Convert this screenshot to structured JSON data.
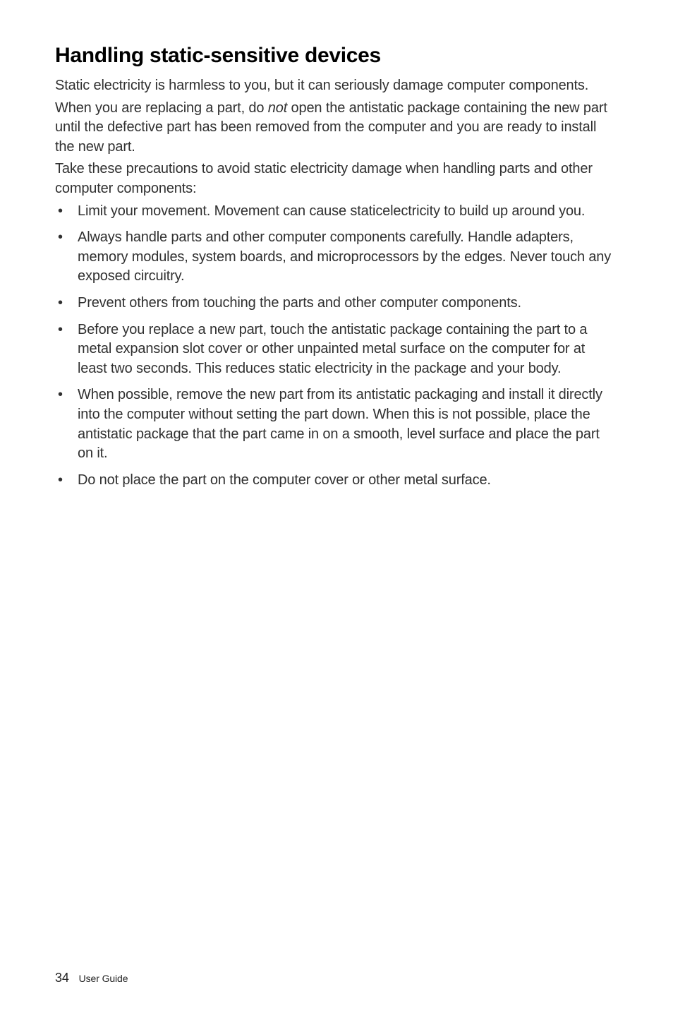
{
  "heading": "Handling static-sensitive devices",
  "para1": "Static electricity is harmless to you, but it can seriously damage computer components.",
  "para2_before": "When you are replacing a part, do ",
  "para2_italic": "not",
  "para2_after": " open the antistatic package containing the new part until the defective part has been removed from the computer and you are ready to install the new part.",
  "para3": "Take these precautions to avoid static electricity damage when handling parts and other computer components:",
  "bullets": [
    "Limit your movement. Movement can cause staticelectricity to build up around you.",
    "Always handle parts and other computer components carefully. Handle adapters, memory modules, system boards, and microprocessors by the edges. Never touch any exposed circuitry.",
    "Prevent others from touching the parts and other computer components.",
    "Before you replace a new part, touch the antistatic package containing the part to a metal expansion slot cover or other unpainted metal surface on the computer for at least two seconds. This reduces static electricity in the package and your body.",
    "When possible, remove the new part from its antistatic packaging and install it directly into the computer without setting the part down. When this is not possible, place the antistatic package that the part came in on a smooth, level surface and place the part on it.",
    "Do not place the part on the computer cover or other metal surface."
  ],
  "footer": {
    "page_number": "34",
    "label": "User Guide"
  }
}
